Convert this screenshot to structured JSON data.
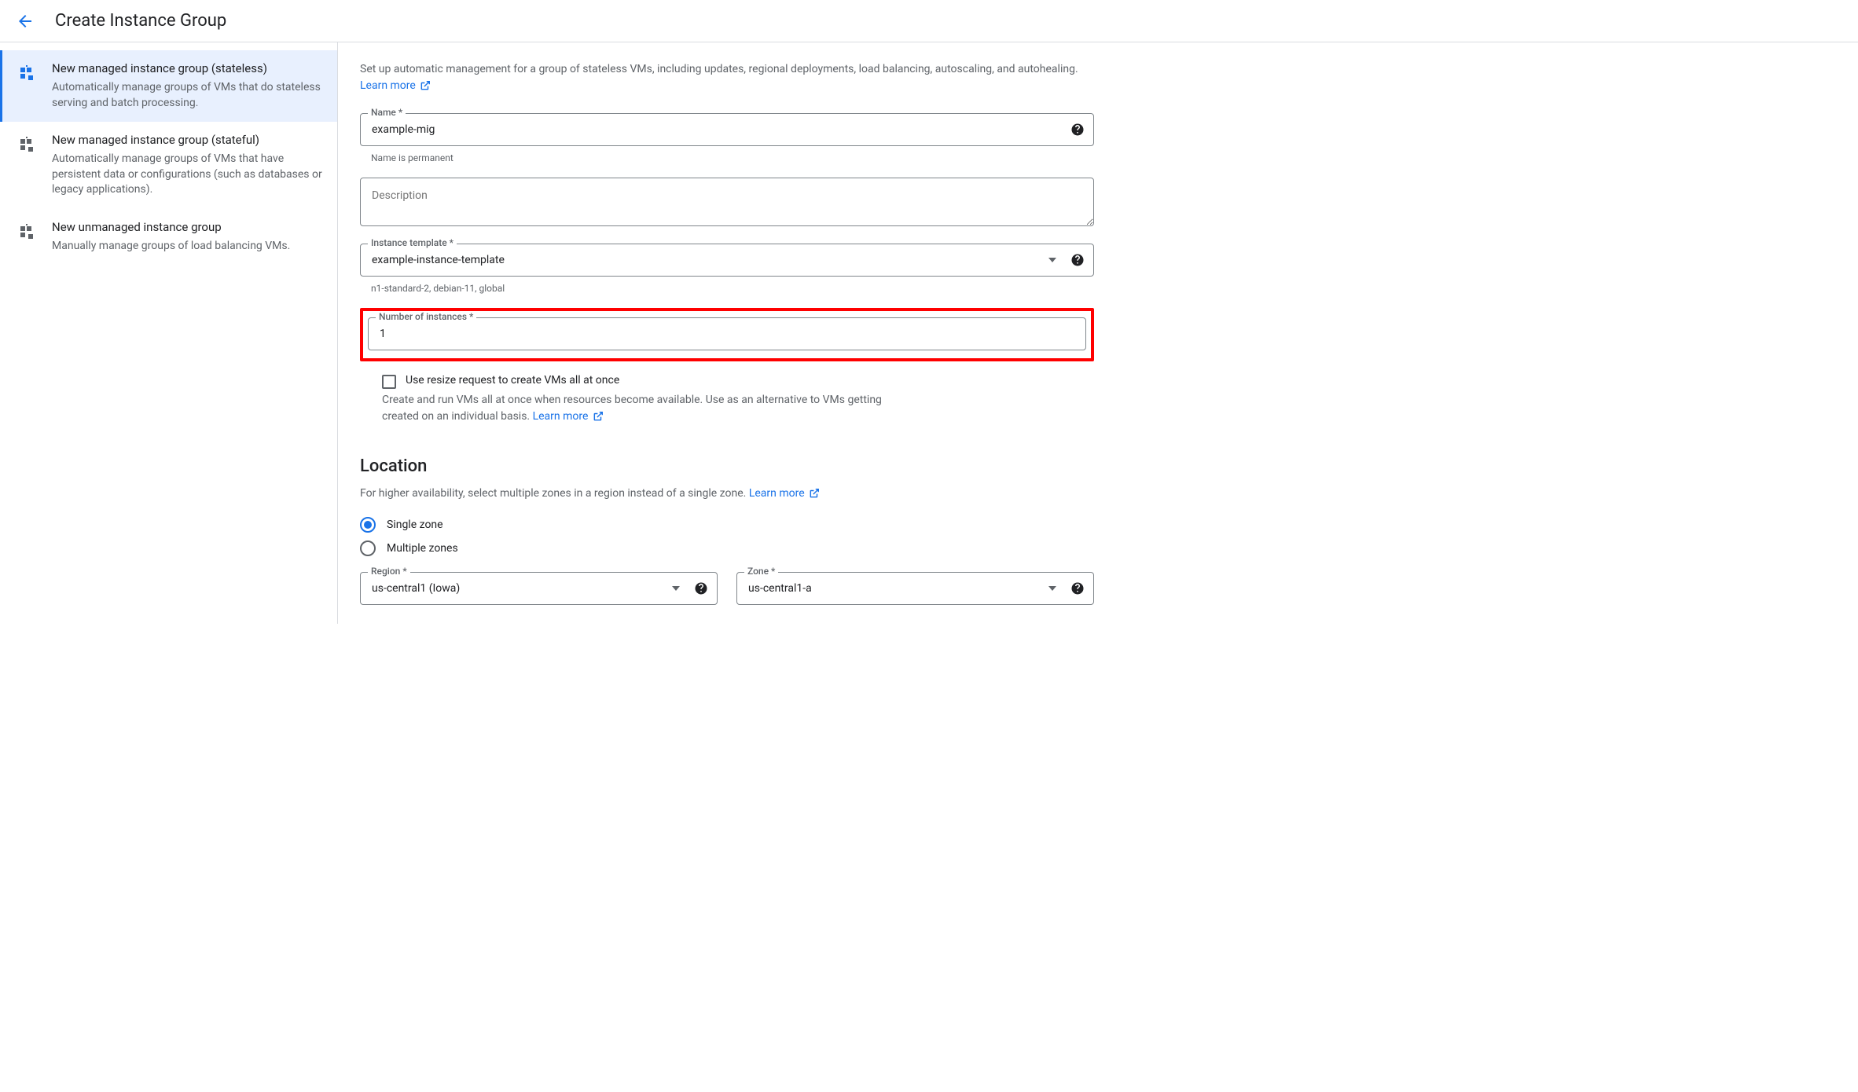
{
  "header": {
    "title": "Create Instance Group"
  },
  "sidebar": [
    {
      "title": "New managed instance group (stateless)",
      "desc": "Automatically manage groups of VMs that do stateless serving and batch processing.",
      "active": true
    },
    {
      "title": "New managed instance group (stateful)",
      "desc": "Automatically manage groups of VMs that have persistent data or configurations (such as databases or legacy applications).",
      "active": false
    },
    {
      "title": "New unmanaged instance group",
      "desc": "Manually manage groups of load balancing VMs.",
      "active": false
    }
  ],
  "intro": {
    "text": "Set up automatic management for a group of stateless VMs, including updates, regional deployments, load balancing, autoscaling, and autohealing. ",
    "learn_more": "Learn more"
  },
  "name": {
    "label": "Name *",
    "value": "example-mig",
    "helper": "Name is permanent"
  },
  "description": {
    "placeholder": "Description"
  },
  "instance_template": {
    "label": "Instance template *",
    "value": "example-instance-template",
    "helper": "n1-standard-2, debian-11, global"
  },
  "num_instances": {
    "label": "Number of instances *",
    "value": "1"
  },
  "resize_request": {
    "label": "Use resize request to create VMs all at once",
    "desc": "Create and run VMs all at once when resources become available. Use as an alternative to VMs getting created on an individual basis. ",
    "learn_more": "Learn more"
  },
  "location": {
    "title": "Location",
    "desc": "For higher availability, select multiple zones in a region instead of a single zone. ",
    "learn_more": "Learn more",
    "single_zone": "Single zone",
    "multiple_zones": "Multiple zones",
    "region": {
      "label": "Region *",
      "value": "us-central1 (Iowa)"
    },
    "zone": {
      "label": "Zone *",
      "value": "us-central1-a"
    }
  }
}
